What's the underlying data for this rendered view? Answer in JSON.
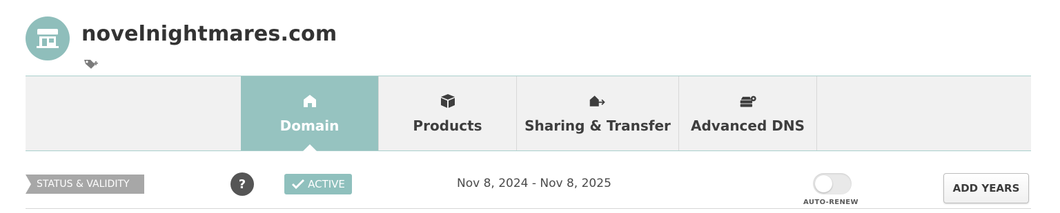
{
  "header": {
    "domain_name": "novelnightmares.com",
    "avatar_icon": "store-icon",
    "tag_icon": "tag-add-icon",
    "accent_color": "#8fbebb"
  },
  "tabs": [
    {
      "label": "Domain",
      "icon": "home-icon",
      "active": true
    },
    {
      "label": "Products",
      "icon": "box-icon",
      "active": false
    },
    {
      "label": "Sharing & Transfer",
      "icon": "house-arrow-icon",
      "active": false
    },
    {
      "label": "Advanced DNS",
      "icon": "server-gear-icon",
      "active": false
    }
  ],
  "status": {
    "label": "STATUS & VALIDITY",
    "help": "?",
    "badge": "ACTIVE",
    "badge_icon": "checkmark-icon",
    "dates": "Nov 8, 2024 - Nov 8, 2025",
    "auto_renew_label": "AUTO-RENEW",
    "auto_renew_enabled": false,
    "add_years_label": "ADD YEARS"
  }
}
